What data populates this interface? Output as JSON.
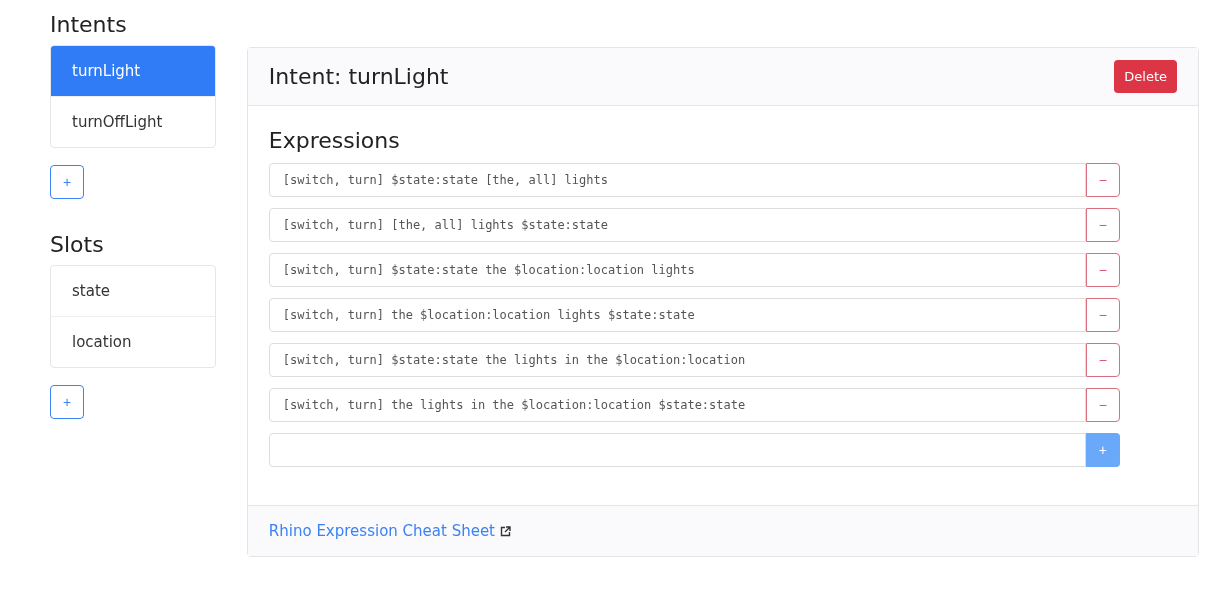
{
  "intents": {
    "heading": "Intents",
    "items": [
      {
        "label": "turnLight",
        "selected": true
      },
      {
        "label": "turnOffLight",
        "selected": false
      }
    ],
    "add_button": "+"
  },
  "slots": {
    "heading": "Slots",
    "items": [
      {
        "label": "state",
        "selected": false
      },
      {
        "label": "location",
        "selected": false
      }
    ],
    "add_button": "+"
  },
  "intent_panel": {
    "title": "Intent: turnLight",
    "delete_button": "Delete",
    "expressions_heading": "Expressions",
    "expressions": [
      {
        "value": "[switch, turn] $state:state [the, all] lights",
        "remove_button": "−"
      },
      {
        "value": "[switch, turn] [the, all] lights $state:state",
        "remove_button": "−"
      },
      {
        "value": "[switch, turn] $state:state the $location:location lights",
        "remove_button": "−"
      },
      {
        "value": "[switch, turn] the $location:location lights $state:state",
        "remove_button": "−"
      },
      {
        "value": "[switch, turn] $state:state the lights in the $location:location",
        "remove_button": "−"
      },
      {
        "value": "[switch, turn] the lights in the $location:location $state:state",
        "remove_button": "−"
      }
    ],
    "add_button": "+",
    "footer_link": "Rhino Expression Cheat Sheet"
  }
}
